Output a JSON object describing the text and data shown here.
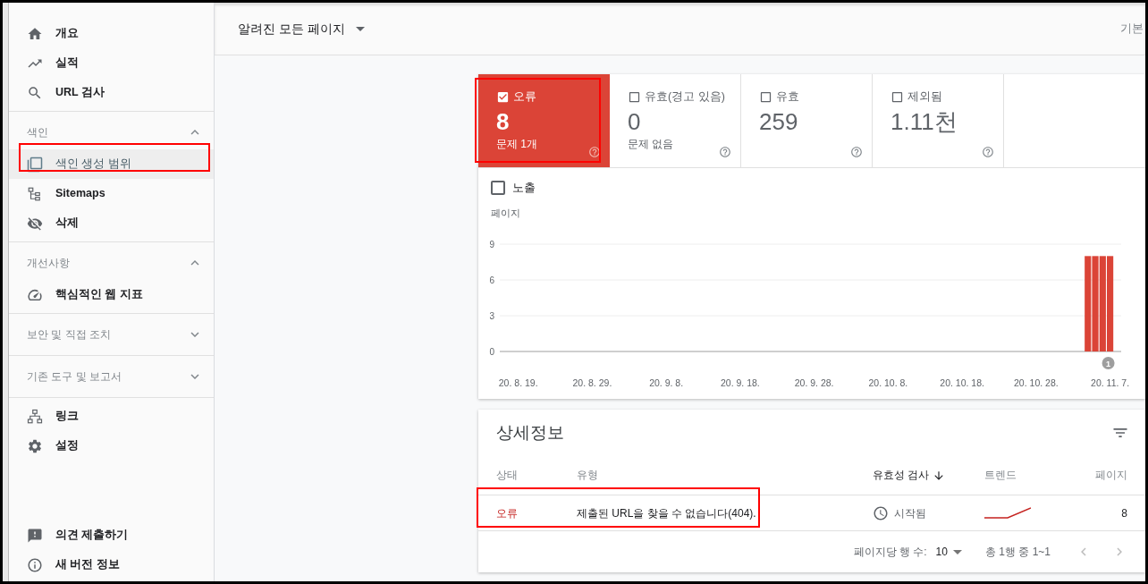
{
  "sidebar": {
    "groups": [
      {
        "items": [
          {
            "label": "개요",
            "selected": false
          },
          {
            "label": "실적",
            "selected": false
          },
          {
            "label": "URL 검사",
            "selected": false
          }
        ]
      },
      {
        "title": "색인",
        "expanded": true,
        "items": [
          {
            "label": "색인 생성 범위",
            "selected": true
          },
          {
            "label": "Sitemaps",
            "selected": false
          },
          {
            "label": "삭제",
            "selected": false
          }
        ]
      },
      {
        "title": "개선사항",
        "expanded": true,
        "items": [
          {
            "label": "핵심적인 웹 지표",
            "selected": false
          }
        ]
      },
      {
        "title": "보안 및 직접 조치",
        "expanded": false
      },
      {
        "title": "기존 도구 및 보고서",
        "expanded": false
      },
      {
        "items": [
          {
            "label": "링크",
            "selected": false
          },
          {
            "label": "설정",
            "selected": false
          }
        ]
      }
    ],
    "footer": [
      {
        "label": "의견 제출하기"
      },
      {
        "label": "새 버전 정보"
      }
    ]
  },
  "header": {
    "dropdown": "알려진 모든 페이지",
    "right_text": "기본"
  },
  "status_cards": [
    {
      "label": "오류",
      "value": "8",
      "note": "문제 1개",
      "selected": true
    },
    {
      "label": "유효(경고 있음)",
      "value": "0",
      "note": "문제 없음",
      "selected": false
    },
    {
      "label": "유효",
      "value": "259",
      "selected": false
    },
    {
      "label": "제외됨",
      "value": "1.11천",
      "selected": false
    }
  ],
  "impressions": {
    "label": "노출",
    "checked": false
  },
  "chart": {
    "chart_data": {
      "type": "bar",
      "ylabel": "페이지",
      "categories": [
        null,
        null,
        "20. 8. 19.",
        null,
        null,
        null,
        null,
        null,
        null,
        null,
        null,
        null,
        "20. 8. 29.",
        null,
        null,
        null,
        null,
        null,
        null,
        null,
        null,
        null,
        "20. 9. 8.",
        null,
        null,
        null,
        null,
        null,
        null,
        null,
        null,
        null,
        "20. 9. 18.",
        null,
        null,
        null,
        null,
        null,
        null,
        null,
        null,
        null,
        "20. 9. 28.",
        null,
        null,
        null,
        null,
        null,
        null,
        null,
        null,
        null,
        "20. 10. 8.",
        null,
        null,
        null,
        null,
        null,
        null,
        null,
        null,
        null,
        "20. 10. 18.",
        null,
        null,
        null,
        null,
        null,
        null,
        null,
        null,
        null,
        "20. 10. 28.",
        null,
        null,
        null,
        null,
        null,
        null,
        null,
        null,
        null,
        "20. 11. 7.",
        null
      ],
      "series": [
        {
          "color": "#db4437",
          "values": [
            0,
            0,
            0,
            0,
            0,
            0,
            0,
            0,
            0,
            0,
            0,
            0,
            0,
            0,
            0,
            0,
            0,
            0,
            0,
            0,
            0,
            0,
            0,
            0,
            0,
            0,
            0,
            0,
            0,
            0,
            0,
            0,
            0,
            0,
            0,
            0,
            0,
            0,
            0,
            0,
            0,
            0,
            0,
            0,
            0,
            0,
            0,
            0,
            0,
            0,
            0,
            0,
            0,
            0,
            0,
            0,
            0,
            0,
            0,
            0,
            0,
            0,
            0,
            0,
            0,
            0,
            0,
            0,
            0,
            0,
            0,
            0,
            0,
            0,
            0,
            0,
            0,
            0,
            0,
            8,
            8,
            8,
            8,
            0
          ]
        }
      ],
      "ylim": [
        0,
        9
      ],
      "yticks": [
        0,
        3,
        6,
        9
      ],
      "annotations": [
        "1"
      ]
    }
  },
  "details": {
    "title": "상세정보",
    "columns": [
      {
        "label": "상태",
        "sorted": false
      },
      {
        "label": "유형",
        "sorted": false
      },
      {
        "label": "유효성 검사",
        "sorted": true
      },
      {
        "label": "트렌드",
        "sorted": false
      },
      {
        "label": "페이지",
        "sorted": false
      }
    ],
    "rows": [
      {
        "status": "오류",
        "type": "제출된 URL을 찾을 수 없습니다(404).",
        "validation": "시작됨",
        "pages": "8"
      }
    ],
    "pagination": {
      "rows_per_page_label": "페이지당 행 수:",
      "rows_per_page": "10",
      "range": "총 1행 중 1~1"
    }
  }
}
